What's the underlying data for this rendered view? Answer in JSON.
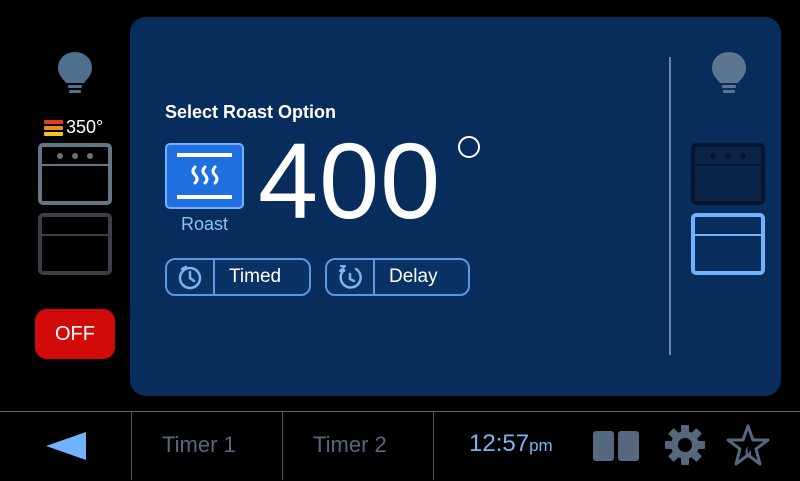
{
  "left_rail": {
    "upper_oven_temp": "350°",
    "off_label": "OFF"
  },
  "panel": {
    "title": "Select Roast Option",
    "mode_label": "Roast",
    "temperature": "400",
    "timed_label": "Timed",
    "delay_label": "Delay"
  },
  "bottom_bar": {
    "timer1": "Timer 1",
    "timer2": "Timer 2",
    "clock_time": "12:57",
    "clock_ampm": "pm"
  },
  "colors": {
    "panel_bg": "#082c5c",
    "accent_blue": "#1f6fe0",
    "off_red": "#d10a0a",
    "heat_red": "#e53a1e",
    "heat_yellow": "#f5c518"
  },
  "icons": [
    "light-bulb-icon",
    "upper-oven-icon",
    "lower-oven-icon",
    "roast-heat-icon",
    "timer-icon",
    "delay-icon",
    "back-arrow-icon",
    "split-view-icon",
    "settings-gear-icon",
    "favorite-star-icon"
  ]
}
